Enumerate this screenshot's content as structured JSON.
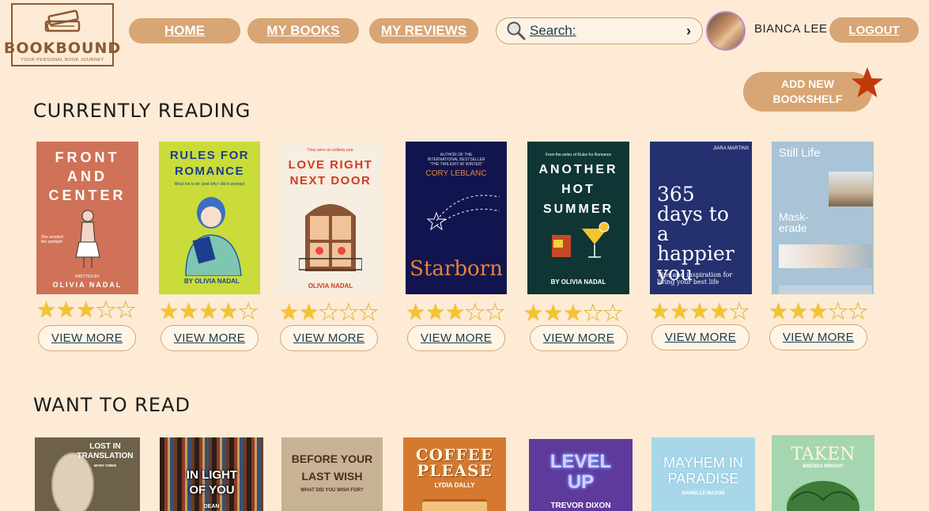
{
  "brand": {
    "name": "BOOKBOUND",
    "tagline": "YOUR PERSONAL BOOK JOURNEY"
  },
  "nav": {
    "home": "HOME",
    "my_books": "MY BOOKS",
    "my_reviews": "MY REVIEWS",
    "logout": "LOGOUT"
  },
  "search": {
    "placeholder": "Search:"
  },
  "user": {
    "name": "BIANCA LEE"
  },
  "add_bookshelf": {
    "line1": "ADD NEW",
    "line2": "BOOKSHELF"
  },
  "colors": {
    "background": "#fdebd5",
    "accent": "#d8a574",
    "star": "#f4c430",
    "badge": "#c0390b"
  },
  "currently_reading": {
    "title": "CURRENTLY READING",
    "view_more_label": "VIEW MORE",
    "books": [
      {
        "title": "FRONT AND CENTER",
        "author": "OLIVIA NADAL",
        "rating": 3
      },
      {
        "title": "RULES FOR ROMANCE",
        "author": "BY OLIVIA NADAL",
        "rating": 4
      },
      {
        "title": "LOVE RIGHT NEXT DOOR",
        "author": "OLIVIA NADAL",
        "rating": 2
      },
      {
        "title": "Starborn",
        "author": "CORY LEBLANC",
        "rating": 3
      },
      {
        "title": "ANOTHER HOT SUMMER",
        "author": "BY OLIVIA NADAL",
        "rating": 3
      },
      {
        "title": "365 days to a happier you",
        "author": "JIARA MARTINS",
        "rating": 4
      },
      {
        "title": "Still Life",
        "author": "",
        "rating": 3
      }
    ]
  },
  "want_to_read": {
    "title": "WANT TO READ",
    "books": [
      {
        "title": "LOST IN TRANSLATION",
        "author": "MARY OWEN"
      },
      {
        "title": "IN LIGHT OF YOU",
        "author": "DEAN"
      },
      {
        "title": "BEFORE YOUR LAST WISH",
        "author": "WHAT DID YOU WISH FOR?"
      },
      {
        "title": "COFFEE PLEASE",
        "author": "LYDIA DALLY"
      },
      {
        "title": "LEVEL UP",
        "author": "TREVOR DIXON"
      },
      {
        "title": "MAYHEM IN PARADISE",
        "author": "DANIELLE MASON"
      },
      {
        "title": "TAKEN",
        "author": "BRENDA WRIGHT"
      }
    ]
  },
  "cover_text": {
    "front_center_sub": "She avoided the spotlight",
    "front_center_written": "WRITTEN BY",
    "rules_sub": "What not to do (and why I did it anyway)",
    "love_pre": "They were an unlikely pair.",
    "starborn_pre": "AUTHOR OF THE INTERNATIONAL BESTSELLER \"THE TWILIGHT AT WINTER\"",
    "summer_pre": "From the writer of Rules for Romance",
    "days_sub": "Tips and inspiration for living your best life",
    "still_sub": "Mask-erade"
  }
}
